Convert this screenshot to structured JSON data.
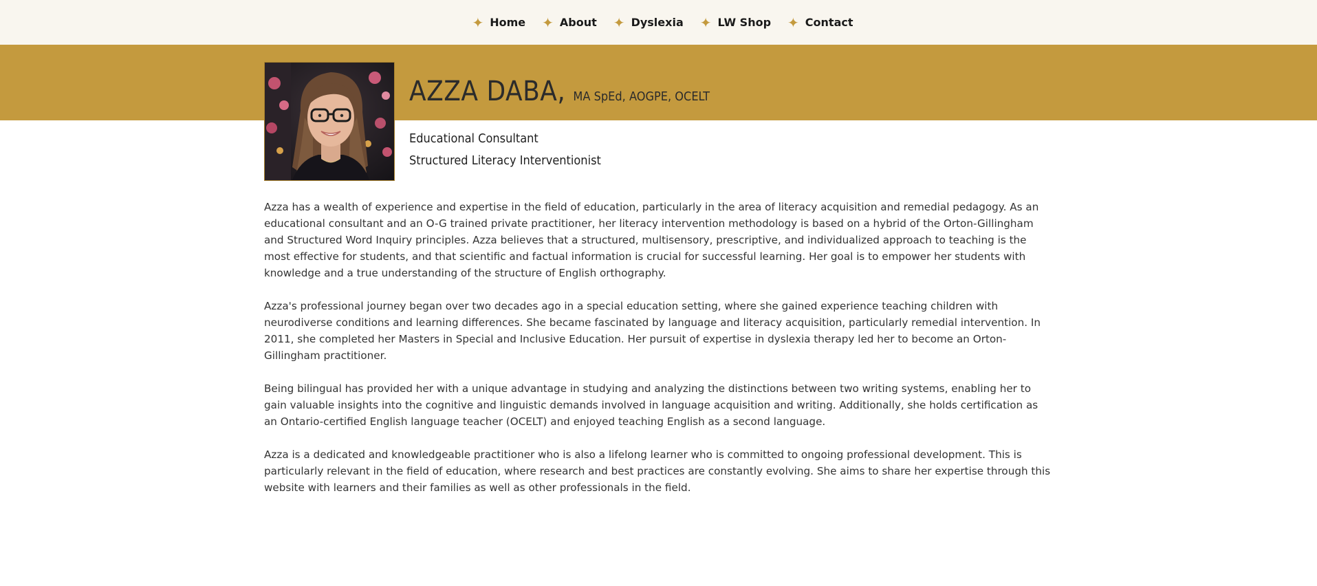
{
  "nav": {
    "items": [
      {
        "label": "Home"
      },
      {
        "label": "About"
      },
      {
        "label": "Dyslexia"
      },
      {
        "label": "LW Shop"
      },
      {
        "label": "Contact"
      }
    ],
    "star_icon": "✦"
  },
  "profile": {
    "name": "AZZA DABA,",
    "credentials": "MA SpEd, AOGPE, OCELT",
    "roles": [
      "Educational Consultant",
      "Structured Literacy Interventionist"
    ],
    "photo_alt": "Portrait of Azza Daba"
  },
  "bio": {
    "paragraphs": [
      "Azza has a wealth of experience and expertise in the field of education, particularly in the area of literacy acquisition and remedial pedagogy. As an educational consultant and an O-G trained private practitioner, her literacy intervention methodology is based on a hybrid of the Orton-Gillingham and Structured Word Inquiry principles. Azza believes that a structured, multisensory, prescriptive, and individualized approach to teaching is the most effective for students, and that scientific and factual information is crucial for successful learning. Her goal is to empower her students with knowledge and a true understanding of the structure of English orthography.",
      "Azza's professional journey began over two decades ago in a special education setting, where she gained experience teaching children with neurodiverse conditions and learning differences. She became fascinated by language and literacy acquisition, particularly remedial intervention. In 2011, she completed her Masters in Special and Inclusive Education. Her pursuit of expertise in dyslexia therapy led her to become an Orton-Gillingham practitioner.",
      "Being bilingual has provided her with a unique advantage in studying and analyzing the distinctions between two writing systems, enabling her to gain valuable insights into the cognitive and linguistic demands involved in language acquisition and writing. Additionally, she holds certification as an Ontario-certified English language teacher (OCELT) and enjoyed teaching English as a second language.",
      "Azza is a dedicated and knowledgeable practitioner who is also a lifelong learner who is committed to ongoing professional development. This is particularly relevant in the field of education, where research and best practices are constantly evolving. She aims to share her expertise through this website with learners and their families as well as other professionals in the field."
    ]
  },
  "colors": {
    "accent": "#c49a3e",
    "nav_bg": "#f9f6ef",
    "text": "#333333"
  }
}
